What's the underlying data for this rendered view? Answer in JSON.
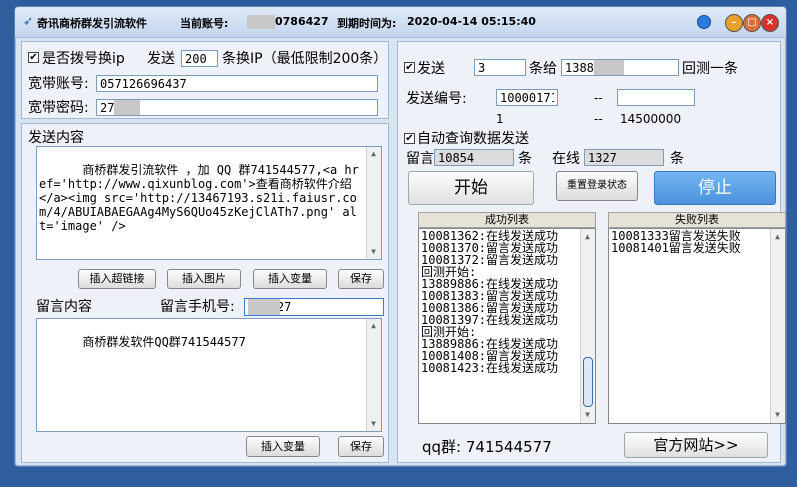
{
  "titlebar": {
    "app_title": "奇讯商桥群发引流软件",
    "account_label": "当前账号:",
    "account_value": "0786427",
    "expire_label": "到期时间为:",
    "expire_value": "2020-04-14 05:15:40"
  },
  "left": {
    "dial_checkbox_label": "是否拨号换ip",
    "send_label": "发送",
    "send_count": "200",
    "switch_label": "条换IP（最低限制200条）",
    "broadband_account_label": "宽带账号:",
    "broadband_account_value": "057126696437",
    "broadband_password_label": "宽带密码:",
    "broadband_password_value": "27",
    "send_content_label": "发送内容",
    "send_content": "商桥群发引流软件 ，加 QQ 群741544577,<a href='http://www.qixunblog.com'>查看商桥软件介绍</a><img src='http://13467193.s21i.faiusr.com/4/ABUIABAEGAAg4MyS6QUo45zKejClATh7.png' alt='image' />",
    "btn_insert_link": "插入超链接",
    "btn_insert_image": "插入图片",
    "btn_insert_variable": "插入变量",
    "btn_save": "保存",
    "message_content_label": "留言内容",
    "message_phone_label": "留言手机号:",
    "message_phone_value": "784927",
    "message_content": "商桥群发软件QQ群741544577",
    "btn_insert_variable2": "插入变量",
    "btn_save2": "保存"
  },
  "right": {
    "send_checkbox_label": "发送",
    "send_value": "3",
    "give_label": "条给",
    "phone_value": "1388",
    "test_label": "回测一条",
    "send_id_label": "发送编号:",
    "send_id_value": "10000171",
    "dash1": "--",
    "range_start": "1",
    "dash2": "--",
    "range_end": "14500000",
    "auto_query_label": "自动查询数据发送",
    "msg_label": "留言",
    "msg_value": "10854",
    "msg_unit": "条",
    "online_label": "在线",
    "online_value": "1327",
    "online_unit": "条",
    "btn_start": "开始",
    "btn_reset_login": "重置登录状态",
    "btn_stop": "停止",
    "success_header": "成功列表",
    "success_items": [
      "10081362:在线发送成功",
      "10081370:留言发送成功",
      "10081372:留言发送成功",
      "回测开始:",
      "13889886:在线发送成功",
      "10081383:留言发送成功",
      "10081386:留言发送成功",
      "10081397:在线发送成功",
      "回测开始:",
      "13889886:在线发送成功",
      "10081408:留言发送成功",
      "10081423:在线发送成功"
    ],
    "fail_header": "失败列表",
    "fail_items": [
      "10081333留言发送失败",
      "10081401留言发送失败"
    ],
    "qq_group": "qq群: 741544577",
    "btn_official_site": "官方网站>>"
  },
  "colors": {
    "desktop": "#2f5e9e",
    "stop_button": "#5aa0e6"
  }
}
